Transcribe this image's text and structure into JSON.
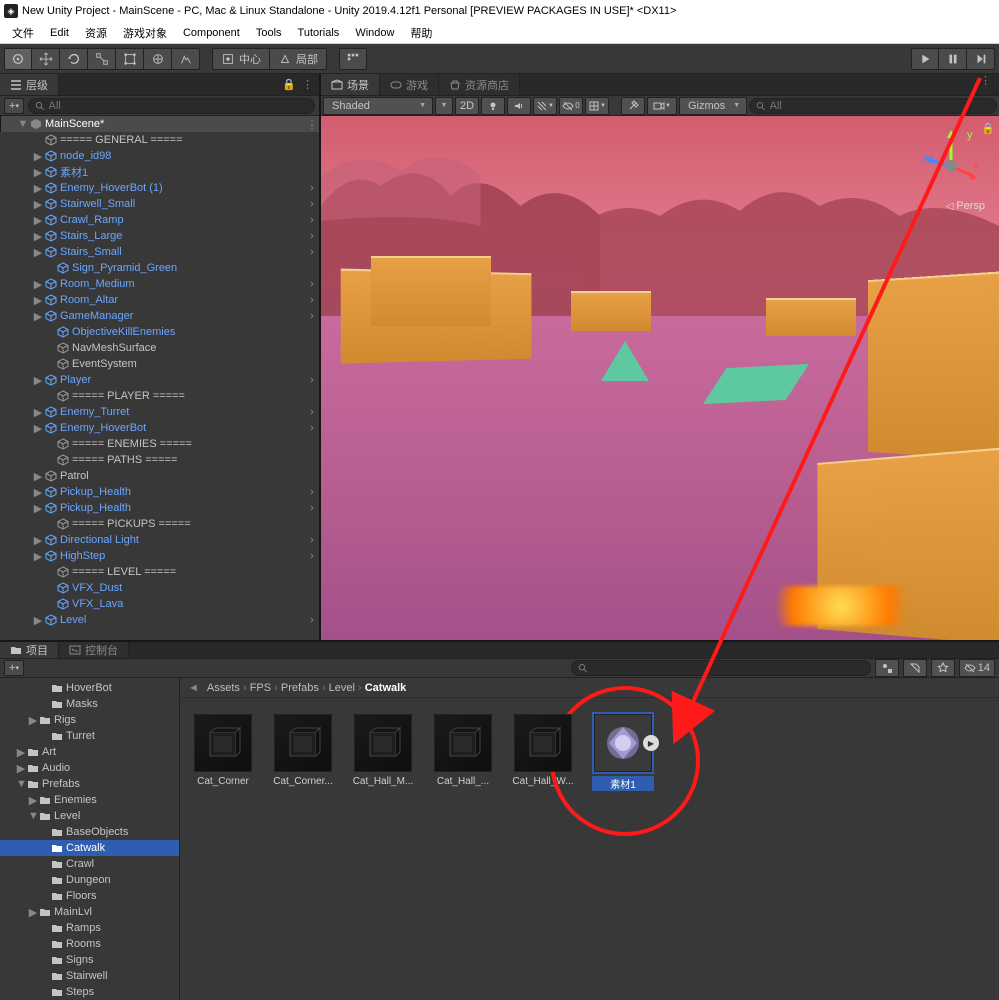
{
  "window": {
    "title": "New Unity Project - MainScene - PC, Mac & Linux Standalone - Unity 2019.4.12f1 Personal [PREVIEW PACKAGES IN USE]* <DX11>"
  },
  "menu": [
    "文件",
    "Edit",
    "资源",
    "游戏对象",
    "Component",
    "Tools",
    "Tutorials",
    "Window",
    "帮助"
  ],
  "toolbar": {
    "center": "中心",
    "local": "局部"
  },
  "hierarchy": {
    "tab": "层级",
    "search_placeholder": "All",
    "scene": "MainScene*",
    "items": [
      {
        "pad": 32,
        "type": "sep",
        "label": "===== GENERAL ====="
      },
      {
        "pad": 32,
        "type": "prefab",
        "label": "node_id98",
        "fold": true
      },
      {
        "pad": 32,
        "type": "prefab",
        "label": "素材1",
        "fold": true
      },
      {
        "pad": 32,
        "type": "prefab",
        "label": "Enemy_HoverBot (1)",
        "fold": true,
        "chev": true
      },
      {
        "pad": 32,
        "type": "prefab",
        "label": "Stairwell_Small",
        "fold": true,
        "chev": true
      },
      {
        "pad": 32,
        "type": "prefab",
        "label": "Crawl_Ramp",
        "fold": true,
        "chev": true
      },
      {
        "pad": 32,
        "type": "prefab",
        "label": "Stairs_Large",
        "fold": true,
        "chev": true
      },
      {
        "pad": 32,
        "type": "prefab",
        "label": "Stairs_Small",
        "fold": true,
        "chev": true
      },
      {
        "pad": 44,
        "type": "prefab",
        "label": "Sign_Pyramid_Green"
      },
      {
        "pad": 32,
        "type": "prefab",
        "label": "Room_Medium",
        "fold": true,
        "chev": true
      },
      {
        "pad": 32,
        "type": "prefab",
        "label": "Room_Altar",
        "fold": true,
        "chev": true
      },
      {
        "pad": 32,
        "type": "prefab",
        "label": "GameManager",
        "fold": true,
        "chev": true
      },
      {
        "pad": 44,
        "type": "prefab",
        "label": "ObjectiveKillEnemies"
      },
      {
        "pad": 44,
        "type": "go",
        "label": "NavMeshSurface"
      },
      {
        "pad": 44,
        "type": "go",
        "label": "EventSystem"
      },
      {
        "pad": 32,
        "type": "prefab",
        "label": "Player",
        "fold": true,
        "chev": true
      },
      {
        "pad": 44,
        "type": "sep",
        "label": "===== PLAYER ====="
      },
      {
        "pad": 32,
        "type": "prefab",
        "label": "Enemy_Turret",
        "fold": true,
        "chev": true
      },
      {
        "pad": 32,
        "type": "prefab",
        "label": "Enemy_HoverBot",
        "fold": true,
        "chev": true
      },
      {
        "pad": 44,
        "type": "sep",
        "label": "===== ENEMIES ====="
      },
      {
        "pad": 44,
        "type": "sep",
        "label": "===== PATHS ====="
      },
      {
        "pad": 32,
        "type": "go",
        "label": "Patrol",
        "fold": true
      },
      {
        "pad": 32,
        "type": "prefab",
        "label": "Pickup_Health",
        "fold": true,
        "chev": true
      },
      {
        "pad": 32,
        "type": "prefab",
        "label": "Pickup_Health",
        "fold": true,
        "chev": true
      },
      {
        "pad": 44,
        "type": "sep",
        "label": "===== PICKUPS ====="
      },
      {
        "pad": 32,
        "type": "prefab",
        "label": "Directional Light",
        "fold": true,
        "chev": true
      },
      {
        "pad": 32,
        "type": "prefab",
        "label": "HighStep",
        "fold": true,
        "chev": true
      },
      {
        "pad": 44,
        "type": "sep",
        "label": "===== LEVEL ====="
      },
      {
        "pad": 44,
        "type": "prefab",
        "label": "VFX_Dust"
      },
      {
        "pad": 44,
        "type": "prefab",
        "label": "VFX_Lava"
      },
      {
        "pad": 32,
        "type": "prefab",
        "label": "Level",
        "fold": true,
        "chev": true
      }
    ]
  },
  "scene": {
    "tabs": [
      "场景",
      "游戏",
      "资源商店"
    ],
    "shading": "Shaded",
    "mode2d": "2D",
    "gizmos": "Gizmos",
    "search_placeholder": "All",
    "persp": "Persp"
  },
  "project": {
    "tabs": [
      "项目",
      "控制台"
    ],
    "visibility_count": "14",
    "search_placeholder": "",
    "breadcrumb": [
      "Assets",
      "FPS",
      "Prefabs",
      "Level",
      "Catwalk"
    ],
    "tree": [
      {
        "pad": 40,
        "label": "HoverBot",
        "type": "folder"
      },
      {
        "pad": 40,
        "label": "Masks",
        "type": "folder"
      },
      {
        "pad": 28,
        "label": "Rigs",
        "type": "folder",
        "fold": true
      },
      {
        "pad": 40,
        "label": "Turret",
        "type": "folder"
      },
      {
        "pad": 16,
        "label": "Art",
        "type": "folder",
        "fold": true
      },
      {
        "pad": 16,
        "label": "Audio",
        "type": "folder",
        "fold": true
      },
      {
        "pad": 16,
        "label": "Prefabs",
        "type": "folder",
        "fold": true,
        "open": true
      },
      {
        "pad": 28,
        "label": "Enemies",
        "type": "folder",
        "fold": true
      },
      {
        "pad": 28,
        "label": "Level",
        "type": "folder",
        "fold": true,
        "open": true
      },
      {
        "pad": 40,
        "label": "BaseObjects",
        "type": "folder"
      },
      {
        "pad": 40,
        "label": "Catwalk",
        "type": "folder",
        "selected": true
      },
      {
        "pad": 40,
        "label": "Crawl",
        "type": "folder"
      },
      {
        "pad": 40,
        "label": "Dungeon",
        "type": "folder"
      },
      {
        "pad": 40,
        "label": "Floors",
        "type": "folder"
      },
      {
        "pad": 28,
        "label": "MainLvl",
        "type": "folder",
        "fold": true
      },
      {
        "pad": 40,
        "label": "Ramps",
        "type": "folder"
      },
      {
        "pad": 40,
        "label": "Rooms",
        "type": "folder"
      },
      {
        "pad": 40,
        "label": "Signs",
        "type": "folder"
      },
      {
        "pad": 40,
        "label": "Stairwell",
        "type": "folder"
      },
      {
        "pad": 40,
        "label": "Steps",
        "type": "folder"
      }
    ],
    "assets": [
      {
        "name": "Cat_Corner",
        "kind": "box"
      },
      {
        "name": "Cat_Corner...",
        "kind": "box"
      },
      {
        "name": "Cat_Hall_M...",
        "kind": "box"
      },
      {
        "name": "Cat_Hall_...",
        "kind": "box"
      },
      {
        "name": "Cat_Hall_W...",
        "kind": "box"
      },
      {
        "name": "素材1",
        "kind": "mat",
        "selected": true
      }
    ]
  }
}
